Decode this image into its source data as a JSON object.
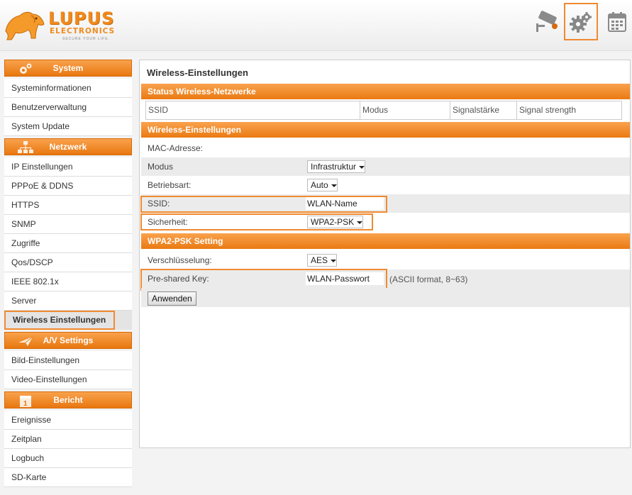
{
  "brand": {
    "name_line1": "LUPUS",
    "name_line2": "ELECTRONICS",
    "tagline": "SECURE YOUR LIFE."
  },
  "toolbar": {
    "icons": [
      "camera-icon",
      "settings-icon",
      "calendar-icon"
    ],
    "active": "settings-icon"
  },
  "colors": {
    "accent": "#f08a30",
    "header_orange": "#ea7a12",
    "highlight_border": "#f08a30"
  },
  "sidebar": {
    "sections": [
      {
        "title": "System",
        "icon": "gears-icon",
        "items": [
          "Systeminformationen",
          "Benutzerverwaltung",
          "System Update"
        ]
      },
      {
        "title": "Netzwerk",
        "icon": "network-icon",
        "items": [
          "IP Einstellungen",
          "PPPoE & DDNS",
          "HTTPS",
          "SNMP",
          "Zugriffe",
          "Qos/DSCP",
          "IEEE 802.1x",
          "Server",
          "Wireless Einstellungen"
        ]
      },
      {
        "title": "A/V Settings",
        "icon": "plane-icon",
        "items": [
          "Bild-Einstellungen",
          "Video-Einstellungen"
        ]
      },
      {
        "title": "Bericht",
        "icon": "calendar-icon",
        "items": [
          "Ereignisse",
          "Zeitplan",
          "Logbuch",
          "SD-Karte"
        ]
      }
    ],
    "active_item": "Wireless Einstellungen"
  },
  "main": {
    "title": "Wireless-Einstellungen",
    "status_section": {
      "title": "Status Wireless-Netzwerke",
      "columns": [
        "SSID",
        "Modus",
        "Signalstärke",
        "Signal strength"
      ]
    },
    "wireless_section": {
      "title": "Wireless-Einstellungen",
      "mac_label": "MAC-Adresse:",
      "mac_value": "",
      "mode_label": "Modus",
      "mode_value": "Infrastruktur",
      "op_label": "Betriebsart:",
      "op_value": "Auto",
      "ssid_label": "SSID:",
      "ssid_value": "WLAN-Name",
      "security_label": "Sicherheit:",
      "security_value": "WPA2-PSK"
    },
    "psk_section": {
      "title": "WPA2-PSK Setting",
      "enc_label": "Verschlüsselung:",
      "enc_value": "AES",
      "key_label": "Pre-shared Key:",
      "key_value": "WLAN-Passwort",
      "key_hint": "(ASCII format, 8~63)"
    },
    "apply_label": "Anwenden"
  }
}
